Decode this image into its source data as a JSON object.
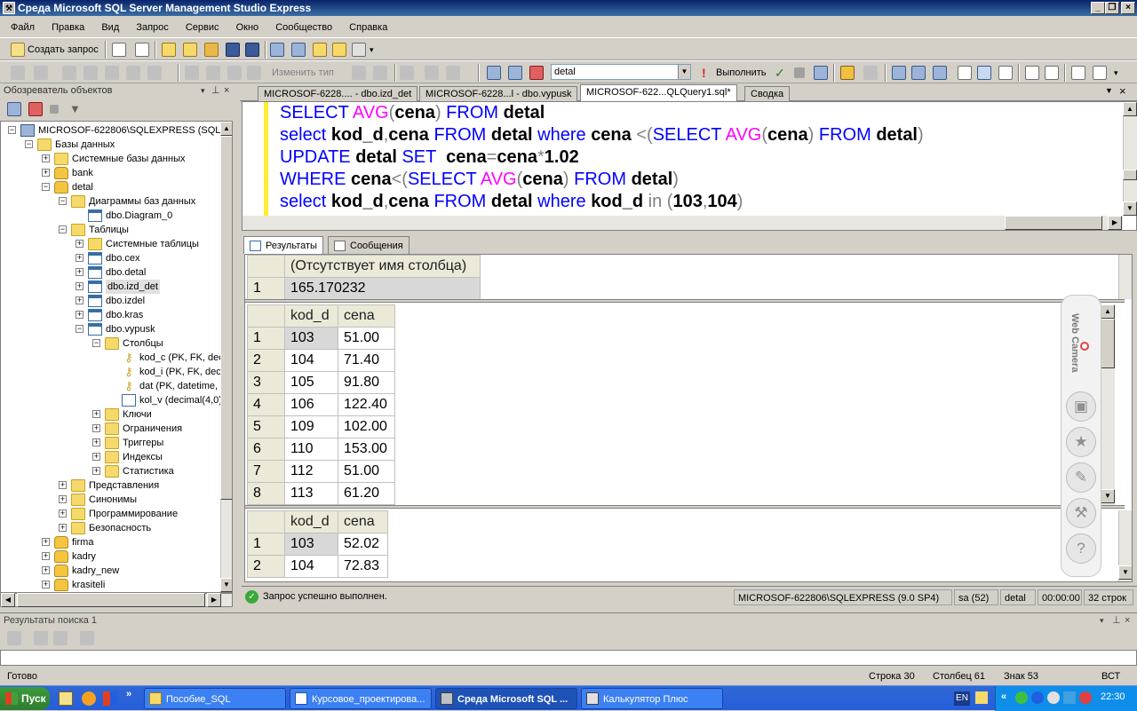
{
  "window": {
    "title": "Среда Microsoft SQL Server Management Studio Express"
  },
  "menu": [
    "Файл",
    "Правка",
    "Вид",
    "Запрос",
    "Сервис",
    "Окно",
    "Сообщество",
    "Справка"
  ],
  "toolbar1": {
    "new_query": "Создать запрос"
  },
  "toolbar2": {
    "change_type": "Изменить тип",
    "database": "detal",
    "execute": "Выполнить"
  },
  "object_explorer": {
    "title": "Обозреватель объектов",
    "nodes": [
      {
        "label": "MICROSOF-622806\\SQLEXPRESS (SQL Ser",
        "icon": "server-icon",
        "expander": "−"
      },
      {
        "label": "Базы данных",
        "icon": "folder-icon",
        "expander": "−"
      },
      {
        "label": "Системные базы данных",
        "icon": "folder-icon",
        "expander": "+"
      },
      {
        "label": "bank",
        "icon": "database-icon",
        "expander": "+"
      },
      {
        "label": "detal",
        "icon": "database-icon",
        "expander": "−"
      },
      {
        "label": "Диаграммы баз данных",
        "icon": "folder-icon",
        "expander": "−"
      },
      {
        "label": "dbo.Diagram_0",
        "icon": "diagram-icon",
        "expander": ""
      },
      {
        "label": "Таблицы",
        "icon": "folder-icon",
        "expander": "−"
      },
      {
        "label": "Системные таблицы",
        "icon": "folder-icon",
        "expander": "+"
      },
      {
        "label": "dbo.cex",
        "icon": "table-icon",
        "expander": "+"
      },
      {
        "label": "dbo.detal",
        "icon": "table-icon",
        "expander": "+"
      },
      {
        "label": "dbo.izd_det",
        "icon": "table-icon",
        "expander": "+"
      },
      {
        "label": "dbo.izdel",
        "icon": "table-icon",
        "expander": "+"
      },
      {
        "label": "dbo.kras",
        "icon": "table-icon",
        "expander": "+"
      },
      {
        "label": "dbo.vypusk",
        "icon": "table-icon",
        "expander": "−"
      },
      {
        "label": "Столбцы",
        "icon": "folder-icon",
        "expander": "−"
      },
      {
        "label": "kod_c (PK, FK, dec",
        "icon": "key-icon",
        "expander": ""
      },
      {
        "label": "kod_i (PK, FK, deci",
        "icon": "key-icon",
        "expander": ""
      },
      {
        "label": "dat (PK, datetime,",
        "icon": "key-icon",
        "expander": ""
      },
      {
        "label": "kol_v (decimal(4,0)",
        "icon": "column-icon",
        "expander": ""
      },
      {
        "label": "Ключи",
        "icon": "folder-icon",
        "expander": "+"
      },
      {
        "label": "Ограничения",
        "icon": "folder-icon",
        "expander": "+"
      },
      {
        "label": "Триггеры",
        "icon": "folder-icon",
        "expander": "+"
      },
      {
        "label": "Индексы",
        "icon": "folder-icon",
        "expander": "+"
      },
      {
        "label": "Статистика",
        "icon": "folder-icon",
        "expander": "+"
      },
      {
        "label": "Представления",
        "icon": "folder-icon",
        "expander": "+"
      },
      {
        "label": "Синонимы",
        "icon": "folder-icon",
        "expander": "+"
      },
      {
        "label": "Программирование",
        "icon": "folder-icon",
        "expander": "+"
      },
      {
        "label": "Безопасность",
        "icon": "folder-icon",
        "expander": "+"
      },
      {
        "label": "firma",
        "icon": "database-icon",
        "expander": "+"
      },
      {
        "label": "kadry",
        "icon": "database-icon",
        "expander": "+"
      },
      {
        "label": "kadry_new",
        "icon": "database-icon",
        "expander": "+"
      },
      {
        "label": "krasiteli",
        "icon": "database-icon",
        "expander": "+"
      }
    ],
    "selected": "dbo.izd_det"
  },
  "tabs": [
    "MICROSOF-6228.... - dbo.izd_det",
    "MICROSOF-6228...l - dbo.vypusk",
    "MICROSOF-622...QLQuery1.sql*",
    "Сводка"
  ],
  "active_tab": "MICROSOF-622...QLQuery1.sql*",
  "result_tabs": [
    "Результаты",
    "Сообщения"
  ],
  "grid1": {
    "header": "(Отсутствует имя столбца)",
    "rows": [
      [
        "1",
        "165.170232"
      ]
    ]
  },
  "grid2": {
    "headers": [
      "kod_d",
      "cena"
    ],
    "rows": [
      [
        "1",
        "103",
        "51.00"
      ],
      [
        "2",
        "104",
        "71.40"
      ],
      [
        "3",
        "105",
        "91.80"
      ],
      [
        "4",
        "106",
        "122.40"
      ],
      [
        "5",
        "109",
        "102.00"
      ],
      [
        "6",
        "110",
        "153.00"
      ],
      [
        "7",
        "112",
        "51.00"
      ],
      [
        "8",
        "113",
        "61.20"
      ]
    ]
  },
  "grid3": {
    "headers": [
      "kod_d",
      "cena"
    ],
    "rows": [
      [
        "1",
        "103",
        "52.02"
      ],
      [
        "2",
        "104",
        "72.83"
      ]
    ]
  },
  "webcam": {
    "label": "Web Camera",
    "icons": [
      "camera-icon",
      "profile-icon",
      "star-icon",
      "edit-icon",
      "wrench-icon",
      "help-icon"
    ]
  },
  "query_status": {
    "message": "Запрос успешно выполнен.",
    "server": "MICROSOF-622806\\SQLEXPRESS (9.0 SP4)",
    "user": "sa (52)",
    "db": "detal",
    "time": "00:00:00",
    "rows": "32 строк"
  },
  "search_results": {
    "title": "Результаты поиска 1"
  },
  "statusbar": {
    "ready": "Готово",
    "line": "Строка 30",
    "col": "Столбец 61",
    "char": "Знак 53",
    "mode": "ВСТ"
  },
  "taskbar": {
    "start": "Пуск",
    "tasks": [
      {
        "label": "Пособие_SQL",
        "active": false
      },
      {
        "label": "Курсовое_проектирова...",
        "active": false
      },
      {
        "label": "Среда Microsoft SQL ...",
        "active": true
      },
      {
        "label": "Калькулятор Плюс",
        "active": false
      }
    ],
    "lang": "EN",
    "clock": "22:30"
  }
}
